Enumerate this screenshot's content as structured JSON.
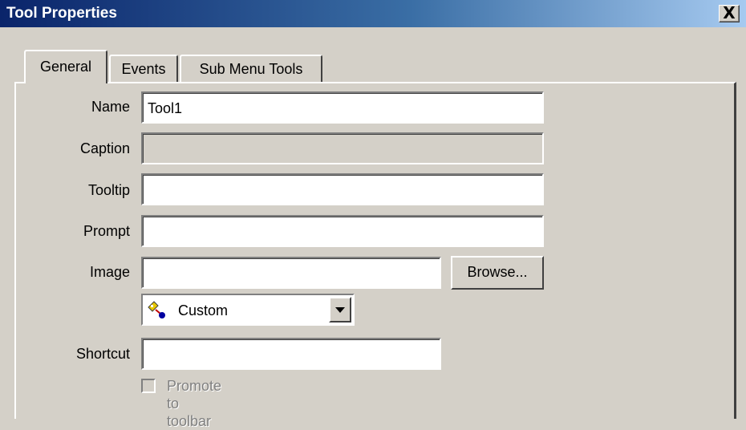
{
  "window": {
    "title": "Tool Properties",
    "close_label": "X"
  },
  "tabs": [
    {
      "label": "General",
      "active": true
    },
    {
      "label": "Events",
      "active": false
    },
    {
      "label": "Sub Menu Tools",
      "active": false
    }
  ],
  "form": {
    "name": {
      "label": "Name",
      "value": "Tool1"
    },
    "caption": {
      "label": "Caption",
      "value": ""
    },
    "tooltip": {
      "label": "Tooltip",
      "value": ""
    },
    "prompt": {
      "label": "Prompt",
      "value": ""
    },
    "image": {
      "label": "Image",
      "value": "",
      "browse_label": "Browse..."
    },
    "cursor": {
      "selected": "Custom",
      "icon": "custom-cursor-icon"
    },
    "shortcut": {
      "label": "Shortcut",
      "value": ""
    },
    "promote": {
      "label": "Promote to toolbar",
      "checked": false,
      "enabled": false
    }
  },
  "colors": {
    "titlebar_start": "#0a246a",
    "titlebar_end": "#a6caf0",
    "face": "#d4d0c8"
  }
}
